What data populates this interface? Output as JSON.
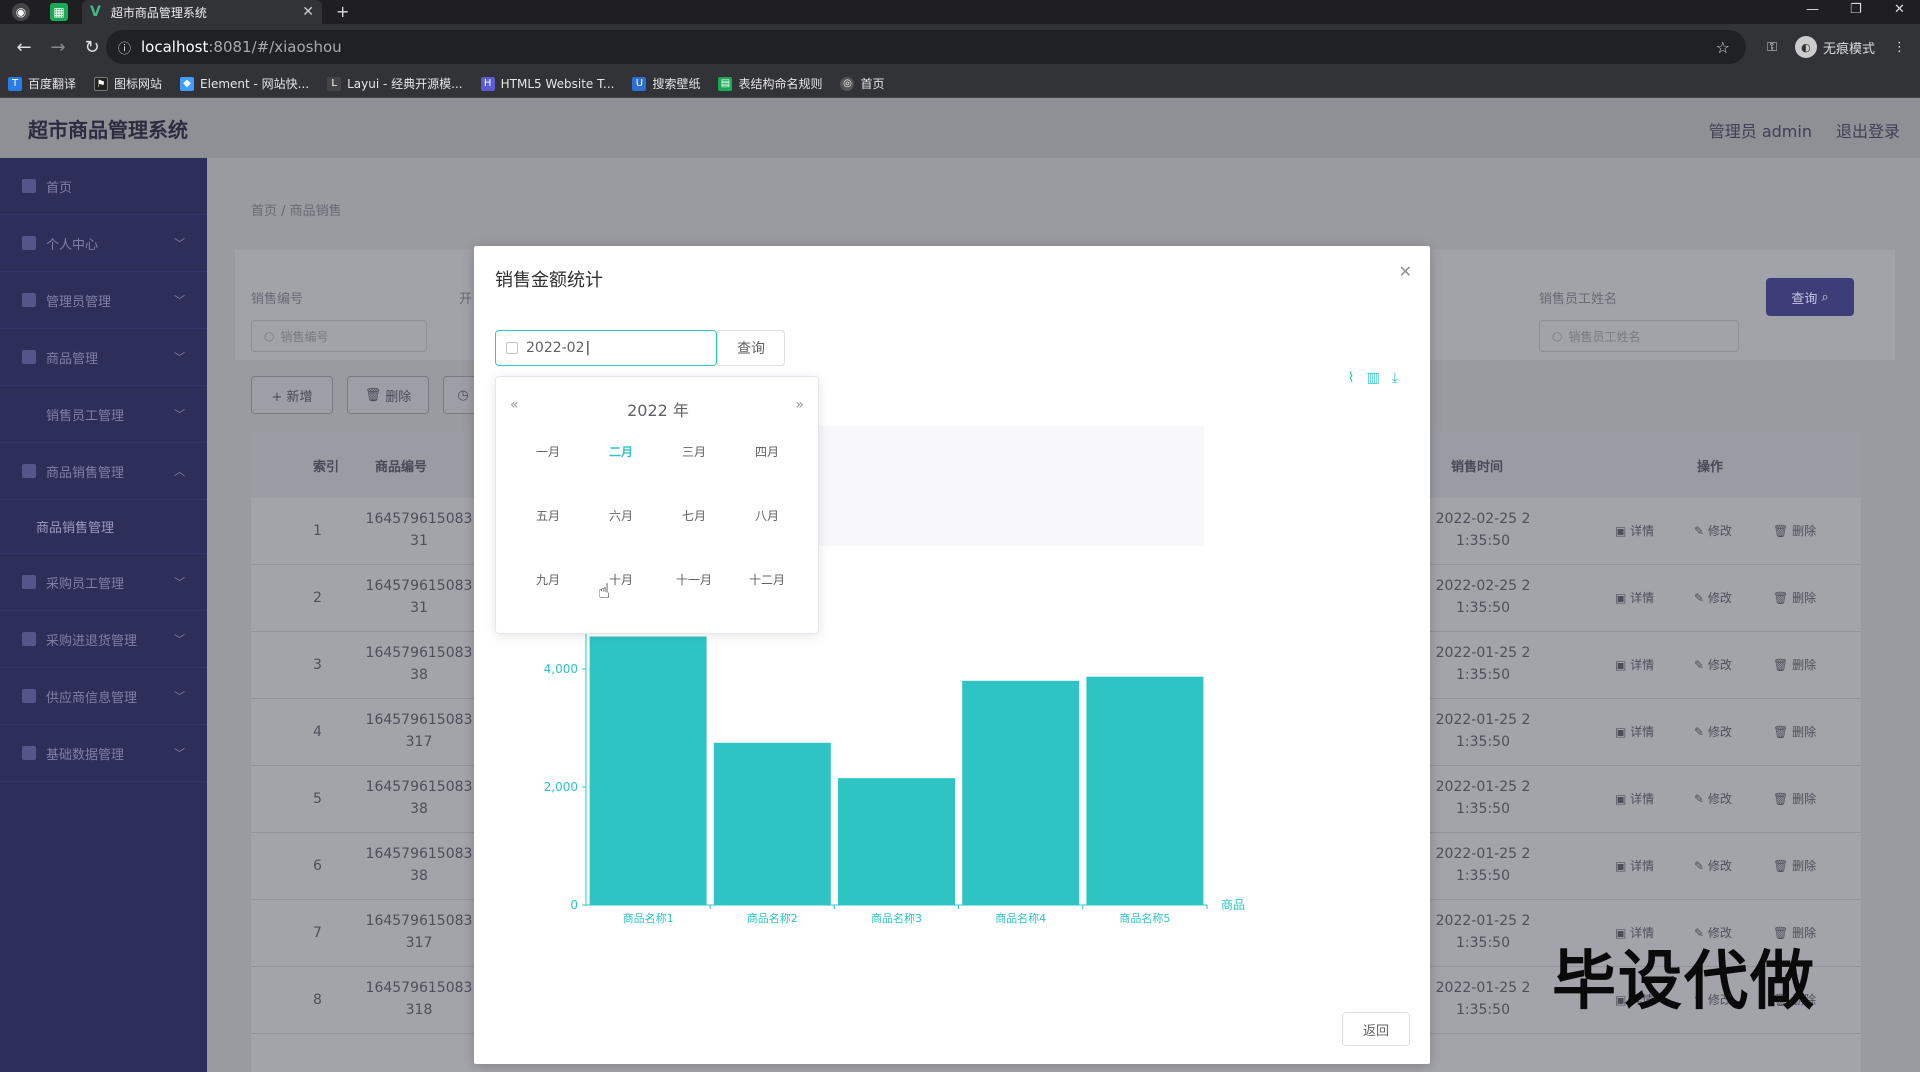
{
  "browser": {
    "tab_title": "超市商品管理系统",
    "url_host": "localhost",
    "url_path": ":8081/#/xiaoshou",
    "incognito_label": "无痕模式",
    "bookmarks": [
      "百度翻译",
      "图标网站",
      "Element - 网站快...",
      "Layui - 经典开源模...",
      "HTML5 Website T...",
      "搜索壁纸",
      "表结构命名规则",
      "首页"
    ]
  },
  "header": {
    "title": "超市商品管理系统",
    "admin_label": "管理员 admin",
    "logout_label": "退出登录"
  },
  "sidebar": {
    "items": [
      "首页",
      "个人中心",
      "管理员管理",
      "商品管理",
      "销售员工管理",
      "商品销售管理",
      "商品销售管理",
      "采购员工管理",
      "采购进退货管理",
      "供应商信息管理",
      "基础数据管理"
    ]
  },
  "main": {
    "breadcrumb": "首页 / 商品销售",
    "search": {
      "label_id": "销售编号",
      "placeholder_id": "销售编号",
      "label_time_cut": "开",
      "label_staff": "销售员工姓名",
      "placeholder_staff": "销售员工姓名",
      "query_label": "查询"
    },
    "add_label": "+ 新增",
    "delete_label": "删除",
    "columns": {
      "index": "索引",
      "code": "商品编号",
      "time": "销售时间",
      "ops": "操作"
    },
    "rows": [
      {
        "index": "1",
        "code_a": "164579615083",
        "code_b": "31",
        "time_a": "2022-02-25 2",
        "time_b": "1:35:50"
      },
      {
        "index": "2",
        "code_a": "164579615083",
        "code_b": "31",
        "time_a": "2022-02-25 2",
        "time_b": "1:35:50"
      },
      {
        "index": "3",
        "code_a": "164579615083",
        "code_b": "38",
        "time_a": "2022-01-25 2",
        "time_b": "1:35:50"
      },
      {
        "index": "4",
        "code_a": "164579615083",
        "code_b": "317",
        "time_a": "2022-01-25 2",
        "time_b": "1:35:50"
      },
      {
        "index": "5",
        "code_a": "164579615083",
        "code_b": "38",
        "time_a": "2022-01-25 2",
        "time_b": "1:35:50"
      },
      {
        "index": "6",
        "code_a": "164579615083",
        "code_b": "38",
        "time_a": "2022-01-25 2",
        "time_b": "1:35:50"
      },
      {
        "index": "7",
        "code_a": "164579615083",
        "code_b": "317",
        "time_a": "2022-01-25 2",
        "time_b": "1:35:50"
      },
      {
        "index": "8",
        "code_a": "164579615083",
        "code_b": "318",
        "time_a": "2022-01-25 2",
        "time_b": "1:35:50"
      }
    ],
    "op_detail": "详情",
    "op_edit": "修改",
    "op_delete": "删除"
  },
  "dialog": {
    "title": "销售金额统计",
    "date_value": "2022-02",
    "query_label": "查询",
    "back_label": "返回",
    "picker": {
      "year_label": "2022 年",
      "months": [
        "一月",
        "二月",
        "三月",
        "四月",
        "五月",
        "六月",
        "七月",
        "八月",
        "九月",
        "十月",
        "十一月",
        "十二月"
      ],
      "selected_index": 1
    }
  },
  "chart_data": {
    "type": "bar",
    "categories": [
      "商品名称1",
      "商品名称2",
      "商品名称3",
      "商品名称4",
      "商品名称5"
    ],
    "values": [
      4550,
      2750,
      2150,
      3800,
      3870
    ],
    "xlabel": "商品",
    "ylabel": "",
    "ylim": [
      0,
      4800
    ],
    "yticks": [
      "0",
      "2,000",
      "4,000"
    ],
    "bar_color": "#2fc4c4"
  },
  "watermark": "毕设代做"
}
